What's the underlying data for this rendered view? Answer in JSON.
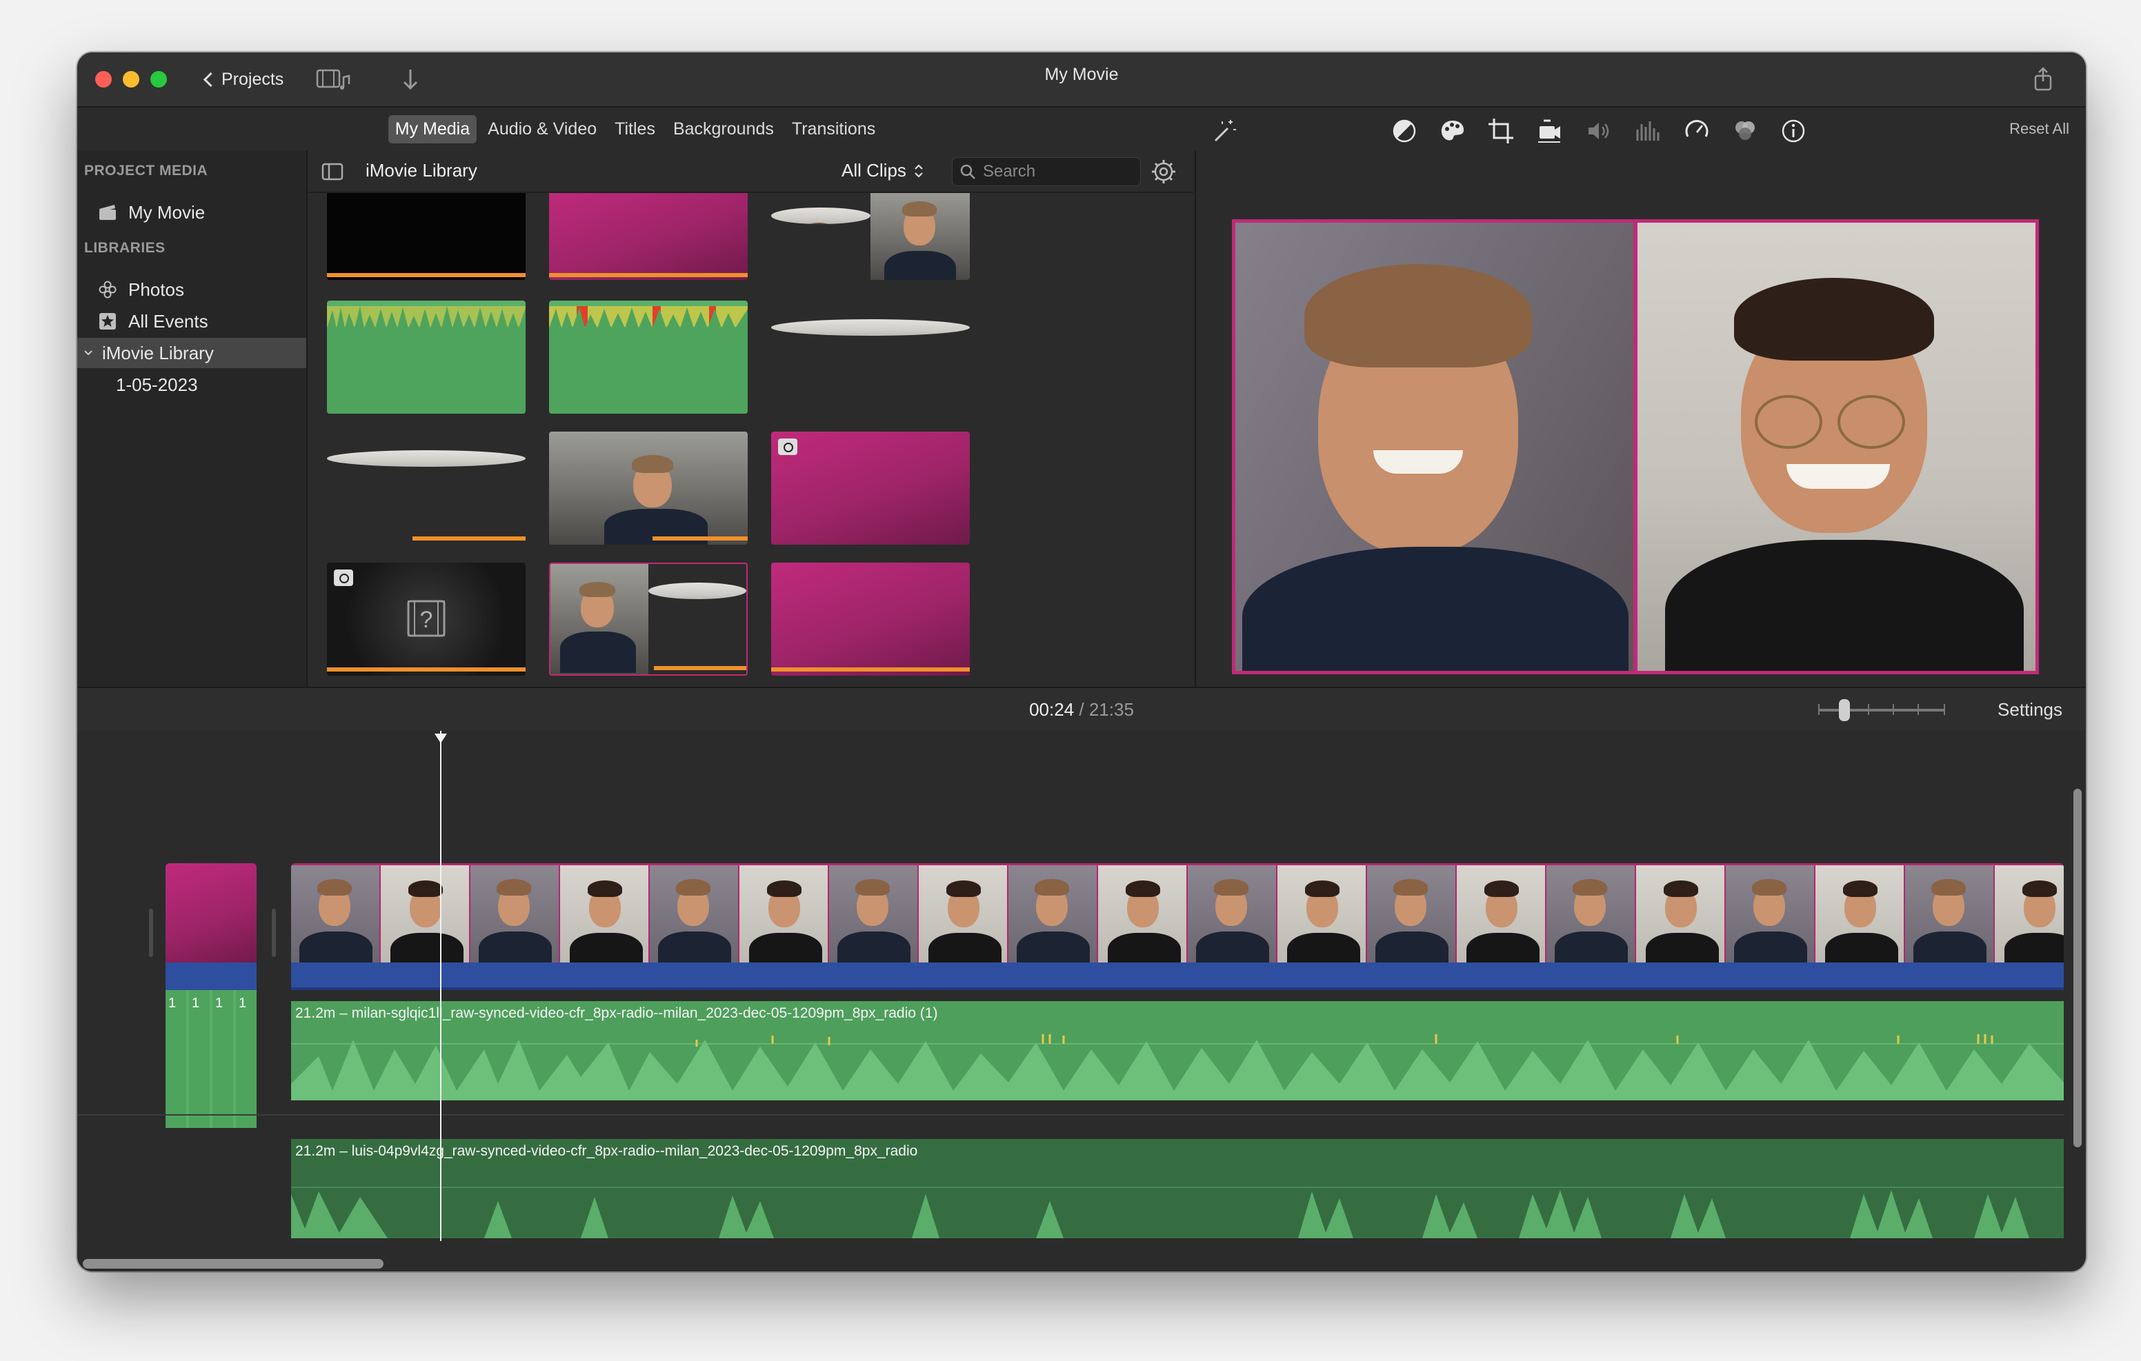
{
  "window": {
    "title": "My Movie",
    "projects_label": "Projects"
  },
  "media_tabs": [
    "My Media",
    "Audio & Video",
    "Titles",
    "Backgrounds",
    "Transitions"
  ],
  "sidebar": {
    "project_media_heading": "PROJECT MEDIA",
    "project_item": "My Movie",
    "libraries_heading": "LIBRARIES",
    "items": [
      {
        "label": "Photos",
        "icon": "photos-icon"
      },
      {
        "label": "All Events",
        "icon": "star-icon"
      },
      {
        "label": "iMovie Library",
        "icon": "disclosure-icon",
        "selected": true
      },
      {
        "label": "1-05-2023",
        "icon": ""
      }
    ]
  },
  "library": {
    "title": "iMovie Library",
    "filter": "All Clips",
    "search_placeholder": "Search"
  },
  "viewer": {
    "reset_all": "Reset All"
  },
  "timeline": {
    "current_time": "00:24",
    "separator": "/",
    "total_time": "21:35",
    "settings_label": "Settings",
    "track1_label": "21.2m – milan-sglqic1ll_raw-synced-video-cfr_8px-radio--milan_2023-dec-05-1209pm_8px_radio (1)",
    "track2_label": "21.2m – luis-04p9vl4zg_raw-synced-video-cfr_8px-radio--milan_2023-dec-05-1209pm_8px_radio",
    "small_clip_labels": [
      "1",
      "1",
      "1",
      "1"
    ]
  },
  "colors": {
    "accent_magenta": "#c02a78",
    "audio_green": "#5ab068",
    "video_blue": "#2e4ea0",
    "progress_orange": "#f0902a"
  }
}
